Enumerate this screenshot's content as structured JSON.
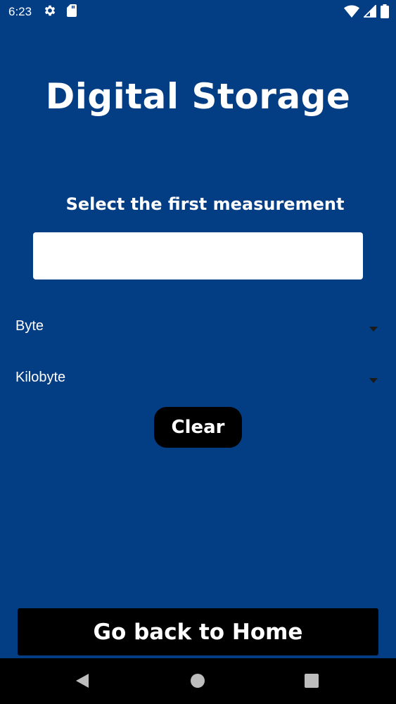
{
  "status_bar": {
    "time": "6:23",
    "left_icons": [
      "gear-icon",
      "sd-card-icon"
    ],
    "right_icons": [
      "wifi-icon",
      "signal-icon",
      "battery-icon"
    ]
  },
  "main": {
    "title": "Digital Storage",
    "subtitle": "Select the first measurement",
    "input": {
      "value": "",
      "placeholder": ""
    },
    "from_unit": {
      "selected": "Byte"
    },
    "to_unit": {
      "selected": "Kilobyte"
    },
    "clear_label": "Clear",
    "home_label": "Go back to Home"
  },
  "navigation": {
    "icons": [
      "back-icon",
      "home-icon",
      "recents-icon"
    ]
  },
  "colors": {
    "background": "#033d84",
    "button": "#000000",
    "text": "#ffffff"
  }
}
